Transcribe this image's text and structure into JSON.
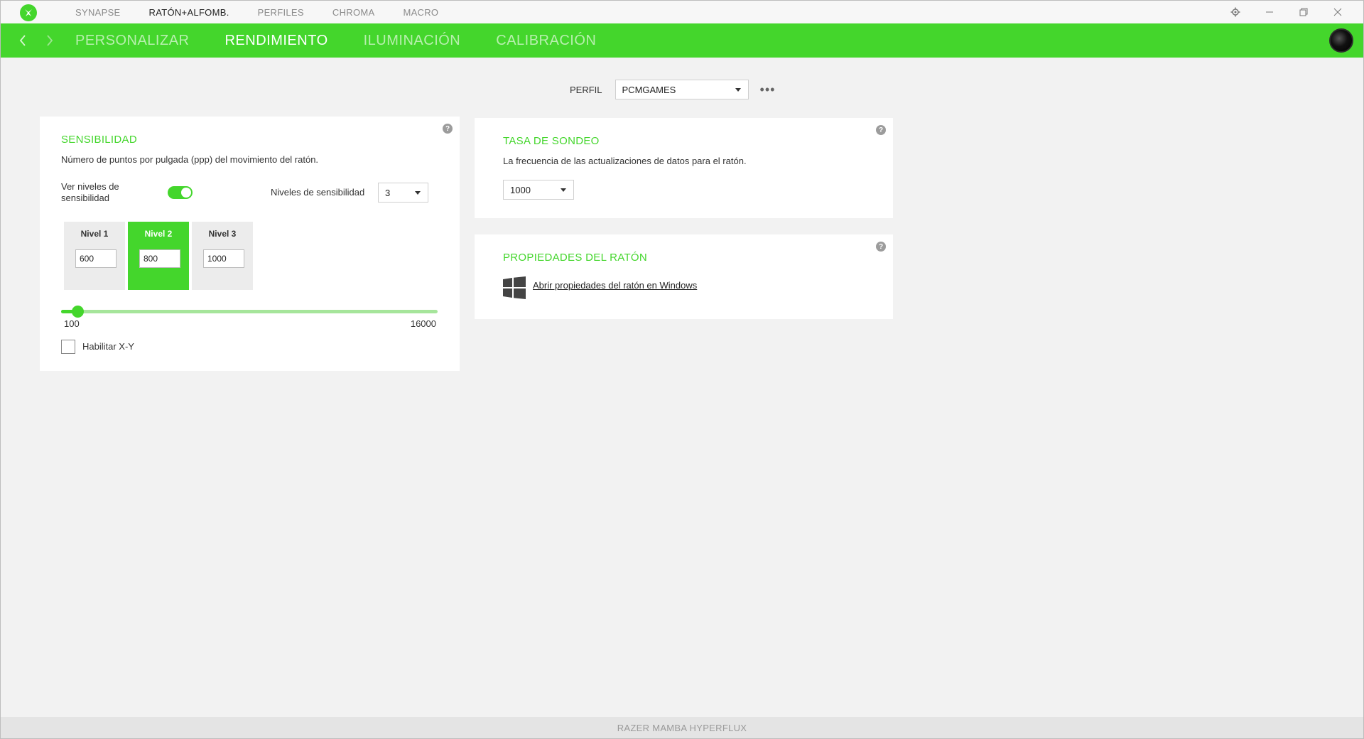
{
  "app": {
    "device_name": "RAZER MAMBA HYPERFLUX"
  },
  "topnav": {
    "items": [
      {
        "label": "SYNAPSE",
        "active": false
      },
      {
        "label": "RATÓN+ALFOMB.",
        "active": true
      },
      {
        "label": "PERFILES",
        "active": false
      },
      {
        "label": "CHROMA",
        "active": false
      },
      {
        "label": "MACRO",
        "active": false
      }
    ]
  },
  "subnav": {
    "tabs": [
      {
        "label": "PERSONALIZAR",
        "active": false
      },
      {
        "label": "RENDIMIENTO",
        "active": true
      },
      {
        "label": "ILUMINACIÓN",
        "active": false
      },
      {
        "label": "CALIBRACIÓN",
        "active": false
      }
    ]
  },
  "profile": {
    "label": "PERFIL",
    "value": "PCMGAMES"
  },
  "sensitivity": {
    "title": "SENSIBILIDAD",
    "description": "Número de puntos por pulgada (ppp) del movimiento del ratón.",
    "show_levels_label_line1": "Ver niveles de",
    "show_levels_label_line2": "sensibilidad",
    "show_levels_on": true,
    "levels_label": "Niveles de sensibilidad",
    "levels_count": "3",
    "levels": [
      {
        "label": "Nivel 1",
        "value": "600",
        "active": false
      },
      {
        "label": "Nivel 2",
        "value": "800",
        "active": true
      },
      {
        "label": "Nivel 3",
        "value": "1000",
        "active": false
      }
    ],
    "slider_min": "100",
    "slider_max": "16000",
    "slider_value": 800,
    "enable_xy_label": "Habilitar X-Y",
    "enable_xy_checked": false
  },
  "polling": {
    "title": "TASA DE SONDEO",
    "description": "La frecuencia de las actualizaciones de datos para el ratón.",
    "value": "1000"
  },
  "mouse_props": {
    "title": "PROPIEDADES DEL RATÓN",
    "link": "Abrir propiedades del ratón en Windows"
  },
  "colors": {
    "accent": "#44d62c",
    "accent_light": "#a6e59b"
  }
}
